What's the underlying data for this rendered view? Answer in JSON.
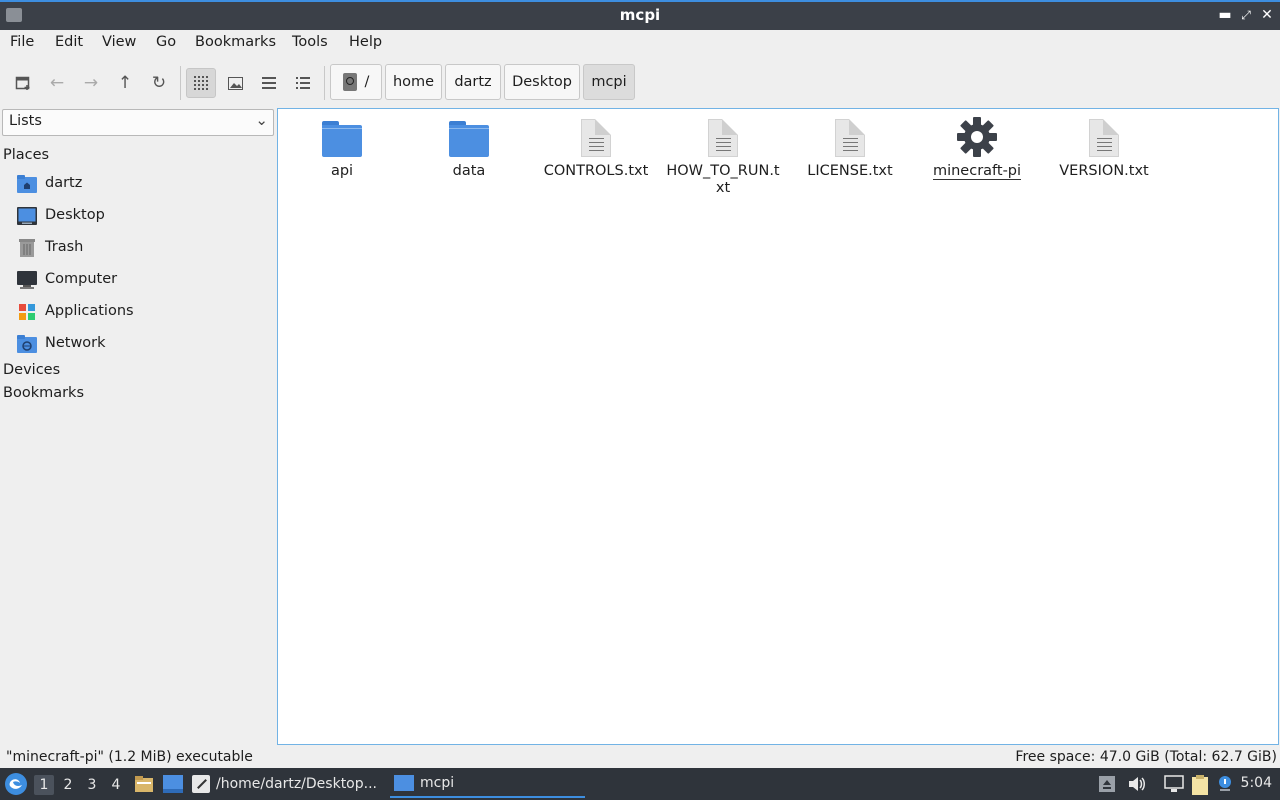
{
  "window": {
    "title": "mcpi"
  },
  "menu": [
    "File",
    "Edit",
    "View",
    "Go",
    "Bookmarks",
    "Tools",
    "Help"
  ],
  "breadcrumb": {
    "root": "/",
    "items": [
      "home",
      "dartz",
      "Desktop",
      "mcpi"
    ]
  },
  "sidebar": {
    "selector": "Lists",
    "places_heading": "Places",
    "places": [
      {
        "label": "dartz",
        "icon": "home-folder-icon"
      },
      {
        "label": "Desktop",
        "icon": "desktop-icon"
      },
      {
        "label": "Trash",
        "icon": "trash-icon"
      },
      {
        "label": "Computer",
        "icon": "computer-icon"
      },
      {
        "label": "Applications",
        "icon": "applications-icon"
      },
      {
        "label": "Network",
        "icon": "network-icon"
      }
    ],
    "devices_heading": "Devices",
    "bookmarks_heading": "Bookmarks"
  },
  "files": [
    {
      "name": "api",
      "type": "folder"
    },
    {
      "name": "data",
      "type": "folder"
    },
    {
      "name": "CONTROLS.txt",
      "type": "text"
    },
    {
      "name": "HOW_TO_RUN.txt",
      "type": "text"
    },
    {
      "name": "LICENSE.txt",
      "type": "text"
    },
    {
      "name": "minecraft-pi",
      "type": "executable",
      "selected": true
    },
    {
      "name": "VERSION.txt",
      "type": "text"
    }
  ],
  "status": {
    "left": "\"minecraft-pi\" (1.2 MiB) executable",
    "right": "Free space: 47.0 GiB (Total: 62.7 GiB)"
  },
  "taskbar": {
    "workspaces": [
      "1",
      "2",
      "3",
      "4"
    ],
    "tasks": [
      {
        "label": "/home/dartz/Desktop..."
      },
      {
        "label": "mcpi"
      }
    ],
    "clock": "5:04"
  },
  "colors": {
    "accent": "#3d8ee0",
    "folder": "#4c8fe1",
    "titlebar": "#3b4048",
    "taskbar": "#2f343b"
  }
}
